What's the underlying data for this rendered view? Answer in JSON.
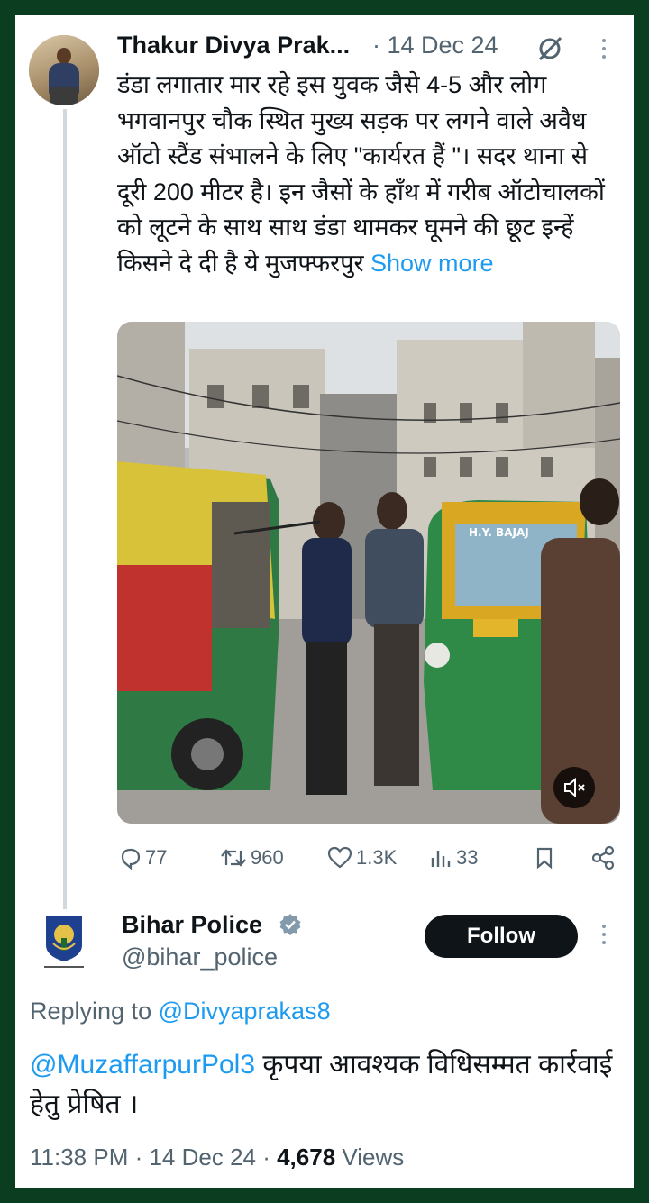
{
  "tweet": {
    "author_name": "Thakur Divya Prak...",
    "date": "· 14 Dec 24",
    "text": "डंडा लगातार मार रहे इस युवक जैसे 4-5 और लोग भगवानपुर चौक स्थित मुख्य सड़क पर लगने वाले अवैध ऑटो स्टैंड संभालने के लिए \"कार्यरत हैं \"। सदर थाना से दूरी 200 मीटर है। इन जैसों के हाँथ में गरीब ऑटोचालकों को लूटने के साथ साथ डंडा थामकर घूमने की छूट इन्हें किसने दे दी है ये मुजफ्फरपुर",
    "show_more": "Show more",
    "media_text": "H.Y. BAJAJ",
    "stats": {
      "replies": "77",
      "retweets": "960",
      "likes": "1.3K",
      "views": "33"
    }
  },
  "reply": {
    "author_name": "Bihar Police",
    "handle": "@bihar_police",
    "follow_label": "Follow",
    "replying_to_label": "Replying to",
    "replying_to_handle": "@Divyaprakas8",
    "mention": "@MuzaffarpurPol3",
    "text": " कृपया आवश्यक विधिसम्मत कार्रवाई  हेतु प्रेषित ।",
    "time": "11:38 PM · 14 Dec 24 · ",
    "views_count": "4,678",
    "views_label": " Views"
  },
  "colors": {
    "frame": "#0b3d21",
    "link": "#1d9bf0",
    "text": "#0f1419",
    "muted": "#536471"
  },
  "icons": [
    "grok-icon",
    "more-icon",
    "reply-icon",
    "retweet-icon",
    "like-icon",
    "views-icon",
    "bookmark-icon",
    "share-icon",
    "mute-icon",
    "verified-icon"
  ]
}
